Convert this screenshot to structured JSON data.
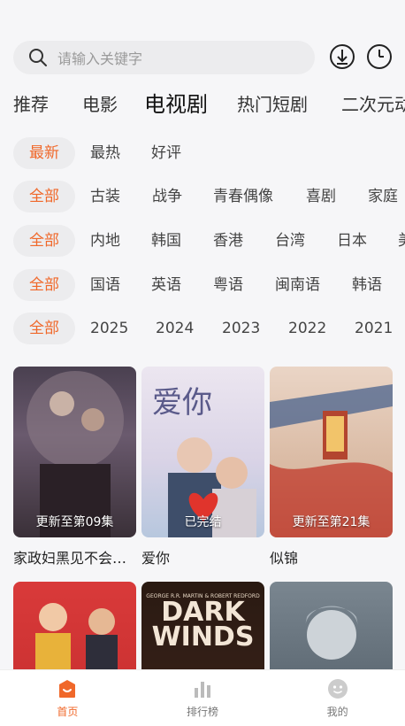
{
  "search": {
    "placeholder": "请输入关键字"
  },
  "categories": [
    "推荐",
    "电影",
    "电视剧",
    "热门短剧",
    "二次元动"
  ],
  "filters": {
    "sort": [
      "最新",
      "最热",
      "好评"
    ],
    "genre": [
      "全部",
      "古装",
      "战争",
      "青春偶像",
      "喜剧",
      "家庭"
    ],
    "region": [
      "全部",
      "内地",
      "韩国",
      "香港",
      "台湾",
      "日本",
      "美"
    ],
    "language": [
      "全部",
      "国语",
      "英语",
      "粤语",
      "闽南语",
      "韩语"
    ],
    "year": [
      "全部",
      "2025",
      "2024",
      "2023",
      "2022",
      "2021"
    ]
  },
  "cards": [
    {
      "badge": "更新至第09集",
      "title": "家政妇黑见不会…"
    },
    {
      "badge": "已完结",
      "title": "爱你",
      "poster_text": "爱你"
    },
    {
      "badge": "更新至第21集",
      "title": "似锦"
    },
    {
      "badge": "",
      "title": ""
    },
    {
      "badge": "",
      "title": "",
      "poster_text1": "DARK",
      "poster_text2": "WINDS",
      "poster_credit": "GEORGE R.R. MARTIN & ROBERT REDFORD"
    },
    {
      "badge": "",
      "title": ""
    }
  ],
  "nav": [
    {
      "label": "首页",
      "icon": "home-icon"
    },
    {
      "label": "排行榜",
      "icon": "chart-icon"
    },
    {
      "label": "我的",
      "icon": "face-icon"
    }
  ],
  "colors": {
    "accent": "#f0682a",
    "chip_bg": "#ececee",
    "bg": "#f6f6f8"
  }
}
